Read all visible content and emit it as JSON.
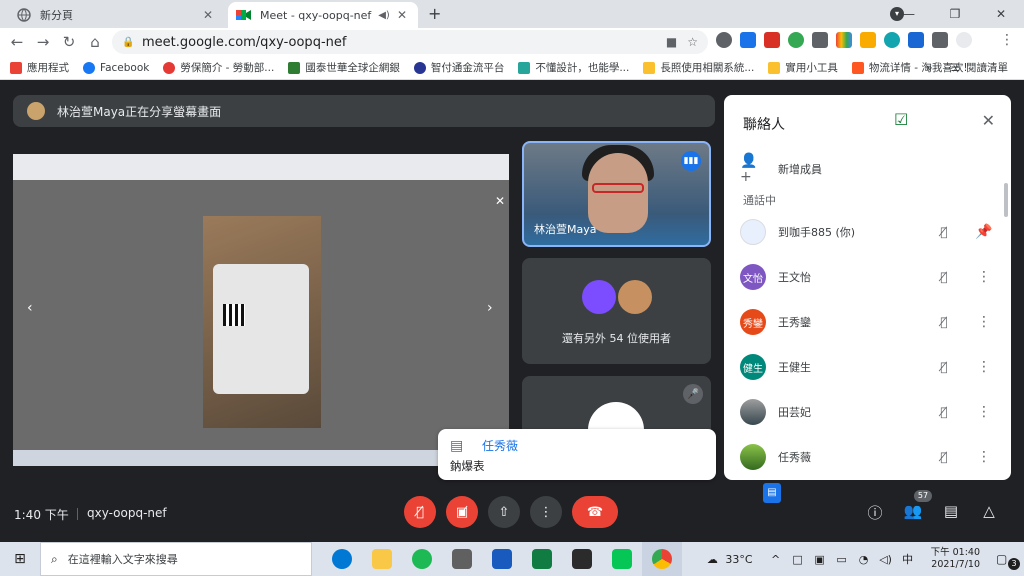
{
  "browser": {
    "tabs": [
      {
        "title": "新分頁",
        "active": false
      },
      {
        "title": "Meet - qxy-oopq-nef",
        "active": true
      }
    ],
    "new_tab": "+",
    "url": "meet.google.com/qxy-oopq-nef",
    "bookmarks": [
      {
        "label": "應用程式",
        "color": "#ea4335"
      },
      {
        "label": "Facebook",
        "color": "#1877f2"
      },
      {
        "label": "勞保簡介 - 勞動部...",
        "color": "#e53935"
      },
      {
        "label": "國泰世華全球企網銀",
        "color": "#2e7d32"
      },
      {
        "label": "智付通金流平台",
        "color": "#283593"
      },
      {
        "label": "不懂設計，也能學...",
        "color": "#26a69a"
      },
      {
        "label": "長照使用相關系統...",
        "color": "#fbc02d"
      },
      {
        "label": "實用小工具",
        "color": "#fbc02d"
      },
      {
        "label": "物流详情 - 淘我喜欢!",
        "color": "#ff5722"
      }
    ],
    "bookmarks_more": "»",
    "reading_list": "閱讀清單"
  },
  "meet": {
    "banner": "林治萱Maya正在分享螢幕畫面",
    "main_speaker": "林治萱Maya",
    "others_count_text": "還有另外 54 位使用者",
    "toast": {
      "name": "任秀薇",
      "message": "鈉爆表"
    },
    "time": "1:40 下午",
    "code": "qxy-oopq-nef",
    "participant_badge": "57"
  },
  "panel": {
    "title": "聯絡人",
    "add_member": "新增成員",
    "section": "通話中",
    "participants": [
      {
        "name": "到咖手885 (你)",
        "initials": "",
        "color": "#ffffff"
      },
      {
        "name": "王文怡",
        "initials": "文怡",
        "color": "#7e57c2"
      },
      {
        "name": "王秀鑾",
        "initials": "秀鑾",
        "color": "#e64a19"
      },
      {
        "name": "王健生",
        "initials": "健生",
        "color": "#00897b"
      },
      {
        "name": "田芸妃",
        "initials": "",
        "color": "#546e7a"
      },
      {
        "name": "任秀薇",
        "initials": "",
        "color": "#7cb342"
      }
    ]
  },
  "taskbar": {
    "search_placeholder": "在這裡輸入文字來搜尋",
    "weather": "33°C",
    "time": "下午 01:40",
    "date": "2021/7/10",
    "notifications": "3"
  }
}
